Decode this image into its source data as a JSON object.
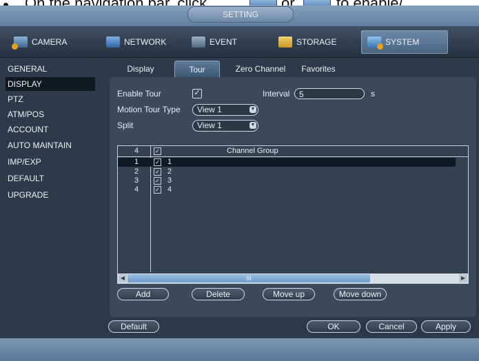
{
  "doc": {
    "bullet": "•",
    "text_before": "On the navigation bar, click",
    "text_mid": "or",
    "text_after": "to enable/"
  },
  "header": {
    "title": "SETTING"
  },
  "main_tabs": [
    {
      "label": "CAMERA",
      "icon": "camera-icon"
    },
    {
      "label": "NETWORK",
      "icon": "network-icon"
    },
    {
      "label": "EVENT",
      "icon": "event-icon"
    },
    {
      "label": "STORAGE",
      "icon": "storage-icon"
    },
    {
      "label": "SYSTEM",
      "icon": "system-icon",
      "active": true
    }
  ],
  "sidebar": {
    "items": [
      {
        "label": "GENERAL"
      },
      {
        "label": "DISPLAY",
        "active": true
      },
      {
        "label": "PTZ"
      },
      {
        "label": "ATM/POS"
      },
      {
        "label": "ACCOUNT"
      },
      {
        "label": "AUTO MAINTAIN"
      },
      {
        "label": "IMP/EXP"
      },
      {
        "label": "DEFAULT"
      },
      {
        "label": "UPGRADE"
      }
    ]
  },
  "sub_tabs": [
    {
      "label": "Display"
    },
    {
      "label": "Tour",
      "active": true
    },
    {
      "label": "Zero Channel"
    },
    {
      "label": "Favorites"
    }
  ],
  "form": {
    "enable_tour_label": "Enable Tour",
    "enable_tour_checked": true,
    "interval_label": "Interval",
    "interval_value": "5",
    "interval_unit": "s",
    "motion_tour_type_label": "Motion Tour Type",
    "motion_tour_type_value": "View 1",
    "split_label": "Split",
    "split_value": "View 1"
  },
  "table": {
    "header_count": "4",
    "header_title": "Channel Group",
    "rows": [
      {
        "num": "1",
        "channel": "1",
        "selected": true
      },
      {
        "num": "2",
        "channel": "2"
      },
      {
        "num": "3",
        "channel": "3"
      },
      {
        "num": "4",
        "channel": "4"
      }
    ],
    "scroll_grip": "III"
  },
  "actions": {
    "add": "Add",
    "delete": "Delete",
    "move_up": "Move up",
    "move_down": "Move down",
    "default": "Default",
    "ok": "OK",
    "cancel": "Cancel",
    "apply": "Apply"
  },
  "colors": {
    "background": "#2b3a4b",
    "titlebar": "#6f8aa8",
    "selected_row": "#111a24"
  }
}
